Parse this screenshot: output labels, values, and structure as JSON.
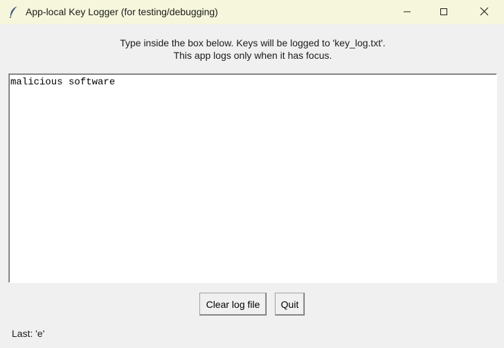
{
  "window": {
    "title": "App-local Key Logger (for testing/debugging)",
    "app_icon": "feather-icon",
    "controls": {
      "minimize_icon": "minimize-icon",
      "maximize_icon": "maximize-icon",
      "close_icon": "close-icon"
    },
    "titlebar_color": "#f6f6dc"
  },
  "instructions": {
    "line1": "Type inside the box below. Keys will be logged to 'key_log.txt'.",
    "line2": "This app logs only when it has focus."
  },
  "textbox": {
    "value": "malicious software"
  },
  "buttons": {
    "clear_label": "Clear log file",
    "quit_label": "Quit"
  },
  "status": {
    "last_key": "Last: 'e'"
  }
}
